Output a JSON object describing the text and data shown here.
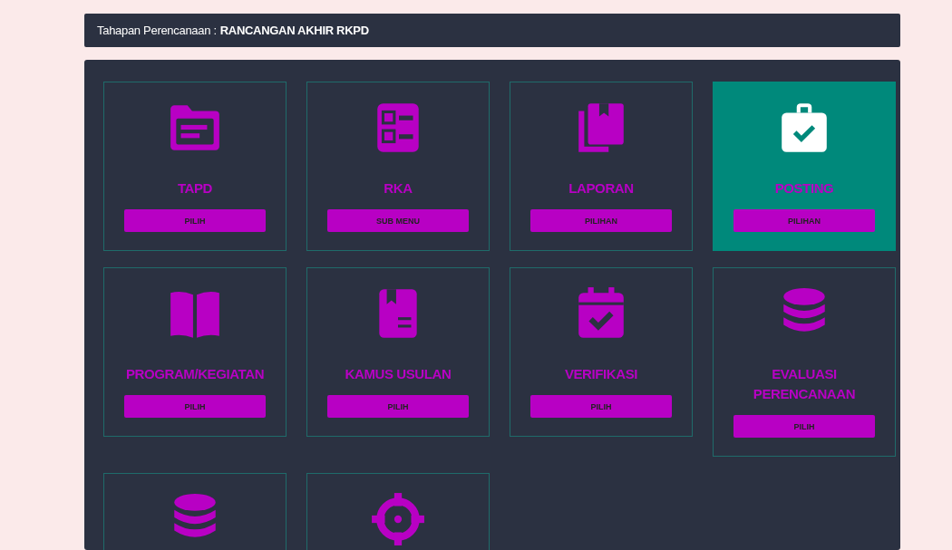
{
  "header": {
    "label": "Tahapan Perencanaan :",
    "value": "RANCANGAN AKHIR RKPD"
  },
  "cards": [
    {
      "kind": "folder",
      "title": "TAPD",
      "button": "PILIH",
      "selected": false
    },
    {
      "kind": "checklist",
      "title": "RKA",
      "button": "SUB MENU",
      "selected": false
    },
    {
      "kind": "books",
      "title": "LAPORAN",
      "button": "PILIHAN",
      "selected": false
    },
    {
      "kind": "briefcase",
      "title": "POSTING",
      "button": "PILIHAN",
      "selected": true
    },
    {
      "kind": "book",
      "title": "PROGRAM/KEGIATAN",
      "button": "PILIH",
      "selected": false
    },
    {
      "kind": "dictionary",
      "title": "KAMUS USULAN",
      "button": "PILIH",
      "selected": false
    },
    {
      "kind": "calendar",
      "title": "VERIFIKASI",
      "button": "PILIH",
      "selected": false
    },
    {
      "kind": "database",
      "title": "EVALUASI PERENCANAAN",
      "button": "PILIH",
      "selected": false
    },
    {
      "kind": "database",
      "selected": false
    },
    {
      "kind": "crosshair",
      "selected": false
    }
  ]
}
